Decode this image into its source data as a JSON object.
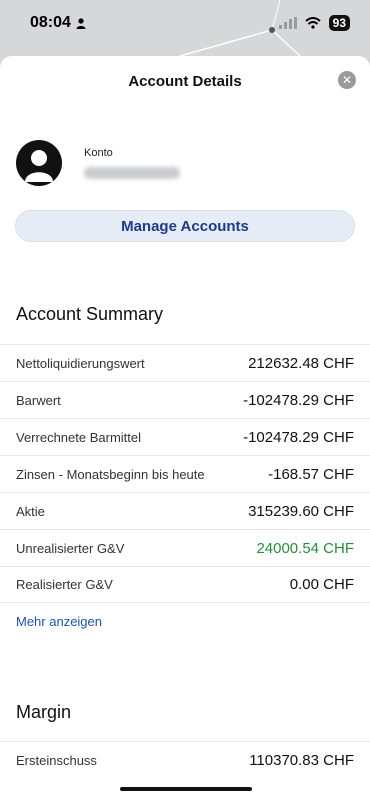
{
  "status_bar": {
    "time": "08:04",
    "battery": "93"
  },
  "sheet": {
    "title": "Account Details",
    "close_icon": "close-icon"
  },
  "account": {
    "label": "Konto"
  },
  "manage_button": "Manage Accounts",
  "summary": {
    "title": "Account Summary",
    "rows": [
      {
        "label": "Nettoliquidierungswert",
        "value": "212632.48 CHF"
      },
      {
        "label": "Barwert",
        "value": "-102478.29 CHF"
      },
      {
        "label": "Verrechnete Barmittel",
        "value": "-102478.29 CHF"
      },
      {
        "label": "Zinsen - Monatsbeginn bis heute",
        "value": "-168.57 CHF"
      },
      {
        "label": "Aktie",
        "value": "315239.60 CHF"
      },
      {
        "label": "Unrealisierter G&V",
        "value": "24000.54 CHF"
      },
      {
        "label": "Realisierter G&V",
        "value": "0.00 CHF"
      }
    ],
    "more_link": "Mehr anzeigen"
  },
  "margin": {
    "title": "Margin",
    "rows": [
      {
        "label": "Ersteinschuss",
        "value": "110370.83 CHF"
      }
    ]
  },
  "colors": {
    "accent": "#1f3a8a",
    "positive": "#2a8a3a",
    "link": "#2152a8"
  }
}
